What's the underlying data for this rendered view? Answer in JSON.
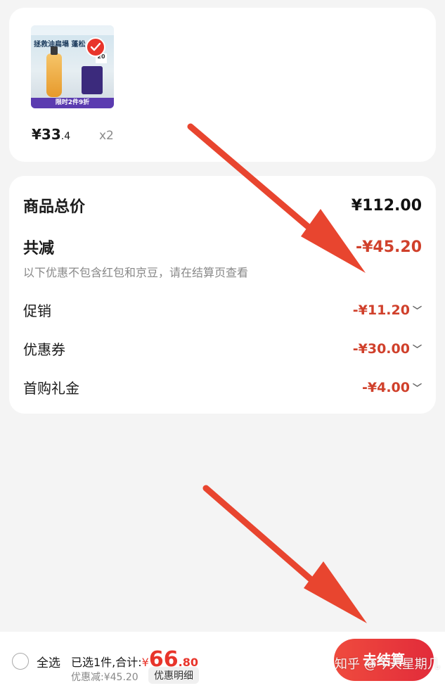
{
  "product": {
    "thumb_headline": "拯救油扁塌 蓬松",
    "thumb_badge": "20",
    "thumb_promo": "限时2件9折",
    "price_main": "¥33",
    "price_decimal": ".4",
    "quantity": "x2"
  },
  "summary": {
    "total_label": "商品总价",
    "total_value": "¥112.00",
    "reduce_label": "共减",
    "reduce_value": "-¥45.20",
    "note": "以下优惠不包含红包和京豆，请在结算页查看",
    "items": [
      {
        "label": "促销",
        "value": "-¥11.20"
      },
      {
        "label": "优惠券",
        "value": "-¥30.00"
      },
      {
        "label": "首购礼金",
        "value": "-¥4.00"
      }
    ]
  },
  "bottom_bar": {
    "select_all": "全选",
    "selected_prefix": "已选1件,合计:",
    "currency": "¥",
    "total_int": "66",
    "total_dec": ".80",
    "discount_text": "优惠减:¥45.20",
    "detail_button": "优惠明细",
    "checkout_button": "去结算"
  },
  "watermark": "知乎 @今天星期几",
  "colors": {
    "accent": "#e8352b",
    "discount_red": "#d0402b",
    "annotation_arrow": "#e8452f"
  }
}
